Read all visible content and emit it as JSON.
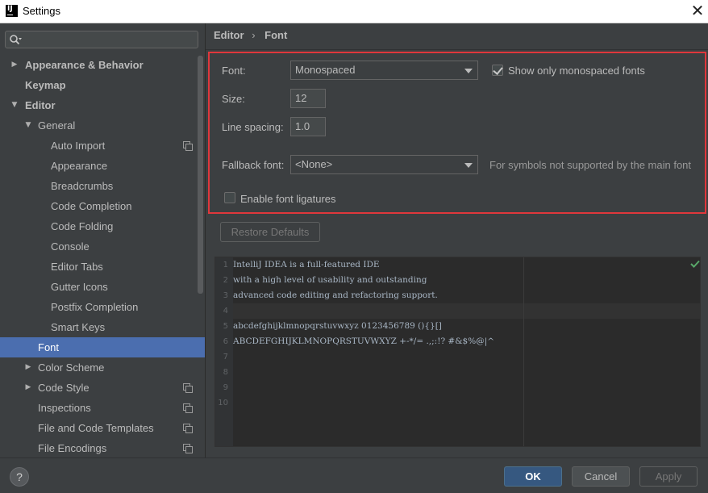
{
  "window": {
    "app_icon": "IJ",
    "title": "Settings",
    "close_icon": "✕"
  },
  "search": {
    "value": "",
    "placeholder": ""
  },
  "sidebar": {
    "items": [
      {
        "label": "Appearance & Behavior",
        "level": 0,
        "bold": true,
        "arrow": "right"
      },
      {
        "label": "Keymap",
        "level": 0,
        "bold": true,
        "arrow": ""
      },
      {
        "label": "Editor",
        "level": 0,
        "bold": true,
        "arrow": "down"
      },
      {
        "label": "General",
        "level": 1,
        "bold": false,
        "arrow": "down"
      },
      {
        "label": "Auto Import",
        "level": 2,
        "bold": false,
        "arrow": "",
        "copy": true
      },
      {
        "label": "Appearance",
        "level": 2,
        "bold": false,
        "arrow": ""
      },
      {
        "label": "Breadcrumbs",
        "level": 2,
        "bold": false,
        "arrow": ""
      },
      {
        "label": "Code Completion",
        "level": 2,
        "bold": false,
        "arrow": ""
      },
      {
        "label": "Code Folding",
        "level": 2,
        "bold": false,
        "arrow": ""
      },
      {
        "label": "Console",
        "level": 2,
        "bold": false,
        "arrow": ""
      },
      {
        "label": "Editor Tabs",
        "level": 2,
        "bold": false,
        "arrow": ""
      },
      {
        "label": "Gutter Icons",
        "level": 2,
        "bold": false,
        "arrow": ""
      },
      {
        "label": "Postfix Completion",
        "level": 2,
        "bold": false,
        "arrow": ""
      },
      {
        "label": "Smart Keys",
        "level": 2,
        "bold": false,
        "arrow": ""
      },
      {
        "label": "Font",
        "level": 1,
        "bold": false,
        "arrow": "",
        "selected": true
      },
      {
        "label": "Color Scheme",
        "level": 1,
        "bold": false,
        "arrow": "right"
      },
      {
        "label": "Code Style",
        "level": 1,
        "bold": false,
        "arrow": "right",
        "copy": true
      },
      {
        "label": "Inspections",
        "level": 1,
        "bold": false,
        "arrow": "",
        "copy": true
      },
      {
        "label": "File and Code Templates",
        "level": 1,
        "bold": false,
        "arrow": "",
        "copy": true
      },
      {
        "label": "File Encodings",
        "level": 1,
        "bold": false,
        "arrow": "",
        "copy": true
      }
    ]
  },
  "breadcrumb": {
    "parent": "Editor",
    "separator": "›",
    "current": "Font"
  },
  "font_settings": {
    "font_label": "Font:",
    "font_value": "Monospaced",
    "show_mono_label": "Show only monospaced fonts",
    "show_mono_checked": true,
    "size_label": "Size:",
    "size_value": "12",
    "line_spacing_label": "Line spacing:",
    "line_spacing_value": "1.0",
    "fallback_label": "Fallback font:",
    "fallback_value": "<None>",
    "fallback_hint": "For symbols not supported by the main font",
    "ligatures_label": "Enable font ligatures",
    "ligatures_checked": false
  },
  "restore_defaults_label": "Restore Defaults",
  "preview": {
    "lines": [
      {
        "num": "1",
        "text": "IntelliJ IDEA is a full-featured IDE"
      },
      {
        "num": "2",
        "text": "with a high level of usability and outstanding"
      },
      {
        "num": "3",
        "text": "advanced code editing and refactoring support."
      },
      {
        "num": "4",
        "text": ""
      },
      {
        "num": "5",
        "text": "abcdefghijklmnopqrstuvwxyz 0123456789 (){}[]"
      },
      {
        "num": "6",
        "text": "ABCDEFGHIJKLMNOPQRSTUVWXYZ +-*/= .,;:!? #&$%@|^"
      },
      {
        "num": "7",
        "text": ""
      },
      {
        "num": "8",
        "text": ""
      },
      {
        "num": "9",
        "text": ""
      },
      {
        "num": "10",
        "text": ""
      }
    ]
  },
  "footer": {
    "help_label": "?",
    "ok_label": "OK",
    "cancel_label": "Cancel",
    "apply_label": "Apply"
  },
  "colors": {
    "background": "#3c3f41",
    "selection": "#4b6eaf",
    "highlight_box": "#e0373c",
    "primary_button": "#365880",
    "editor_bg": "#2b2b2b",
    "check_green": "#59a869"
  }
}
